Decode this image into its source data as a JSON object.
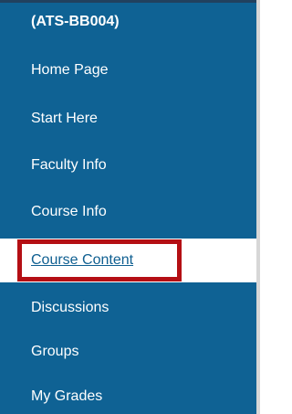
{
  "sidebar": {
    "course_title": "(ATS-BB004)",
    "items": [
      {
        "label": "Home Page"
      },
      {
        "label": "Start Here"
      },
      {
        "label": "Faculty Info"
      },
      {
        "label": "Course Info"
      },
      {
        "label": "Course Content"
      },
      {
        "label": "Discussions"
      },
      {
        "label": "Groups"
      },
      {
        "label": "My Grades"
      }
    ],
    "active_item": "Course Content"
  },
  "colors": {
    "sidebar_background": "#0f6294",
    "active_item_background": "#ffffff",
    "highlight_border": "#b40f14",
    "text_light": "#ffffff",
    "active_text": "#0f5f91"
  }
}
